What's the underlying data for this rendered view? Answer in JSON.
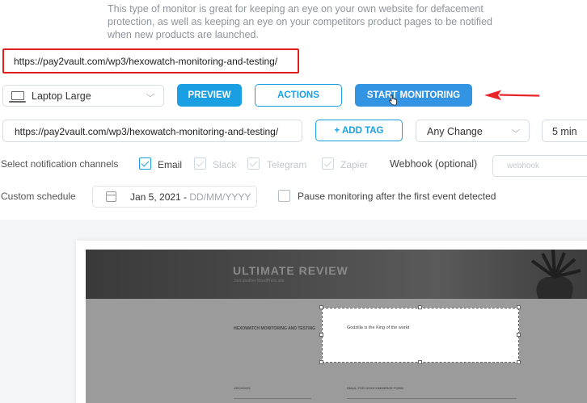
{
  "description": "This type of monitor is great for keeping an eye on your own website for defacement protection, as well as keeping an eye on your competitors product pages to be notified when new products are launched.",
  "top_url": "https://pay2vault.com/wp3/hexowatch-monitoring-and-testing/",
  "toolbar": {
    "device_value": "Laptop Large",
    "preview_label": "PREVIEW",
    "actions_label": "ACTIONS",
    "start_label": "START MONITORING"
  },
  "url_field_value": "https://pay2vault.com/wp3/hexowatch-monitoring-and-testing/",
  "add_tag_label": "+ ADD TAG",
  "change_type_value": "Any Change",
  "interval_value": "5 min",
  "notifications": {
    "label": "Select notification channels",
    "channels": [
      {
        "name": "Email",
        "checked": true,
        "enabled": true
      },
      {
        "name": "Slack",
        "checked": true,
        "enabled": false
      },
      {
        "name": "Telegram",
        "checked": true,
        "enabled": false
      },
      {
        "name": "Zapier",
        "checked": true,
        "enabled": false
      }
    ],
    "webhook_label": "Webhook (optional)",
    "webhook_placeholder": "webhook"
  },
  "schedule": {
    "label": "Custom schedule",
    "date_value": "Jan 5, 2021 - ",
    "date_placeholder": "DD/MM/YYYY",
    "pause_label": "Pause monitoring after the first event detected",
    "pause_checked": false
  },
  "preview": {
    "site_title": "ULTIMATE REVIEW",
    "site_tagline": "Just another WordPress site",
    "post_title": "HEXOWATCH MONITORING AND TESTING",
    "selected_text": "Godzilla is the King of the world",
    "widget_archives": "ARCHIVES",
    "widget_email": "EMAIL FOR WOOCOMMERCE FORM"
  },
  "colors": {
    "accent": "#1b9fe3",
    "start_button": "#3494e4",
    "highlight_border": "#e21d1d",
    "annotation_arrow": "#e8232a"
  }
}
